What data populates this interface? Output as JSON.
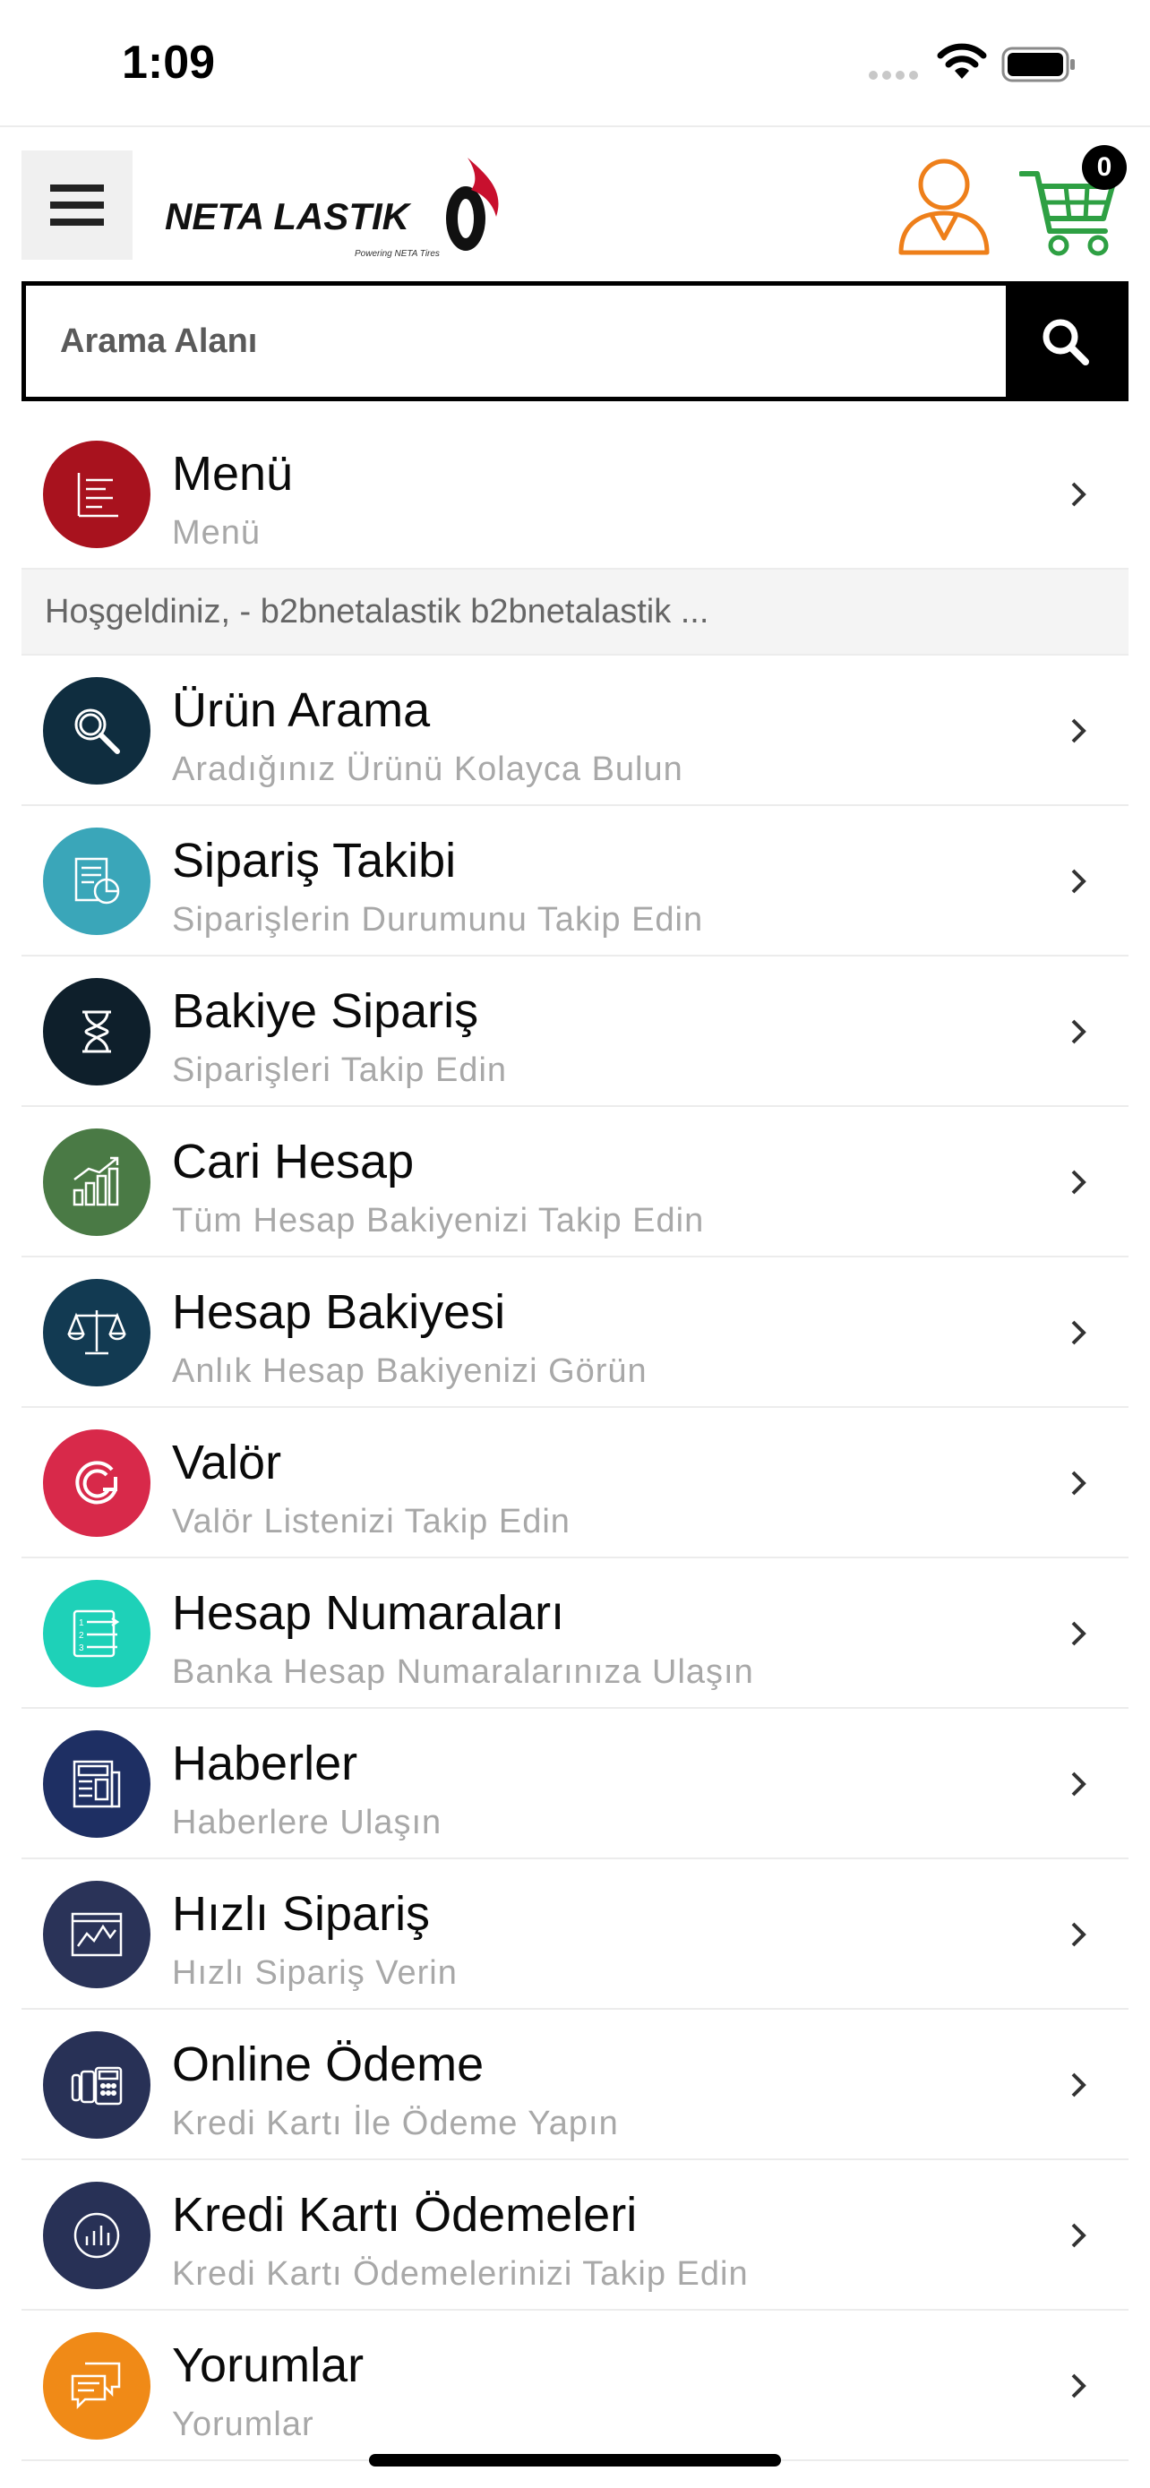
{
  "status": {
    "time": "1:09"
  },
  "header": {
    "logo_text": "NETA LASTIK",
    "logo_tagline": "Powering NETA Tires",
    "cart_count": "0"
  },
  "search": {
    "placeholder": "Arama Alanı"
  },
  "menu_header": {
    "title": "Menü",
    "subtitle": "Menü",
    "icon": "list-icon",
    "color": "#a8121e"
  },
  "welcome": "Hoşgeldiniz, - b2bnetalastik b2bnetalastik ...",
  "items": [
    {
      "title": "Ürün Arama",
      "subtitle": "Aradığınız Ürünü Kolayca Bulun",
      "icon": "magnifier-icon",
      "color": "#0f2d3f"
    },
    {
      "title": "Sipariş Takibi",
      "subtitle": "Siparişlerin Durumunu Takip Edin",
      "icon": "order-tracking-icon",
      "color": "#3aa6b9"
    },
    {
      "title": "Bakiye Sipariş",
      "subtitle": "Siparişleri Takip Edin",
      "icon": "hourglass-icon",
      "color": "#0e1f2b"
    },
    {
      "title": "Cari Hesap",
      "subtitle": "Tüm Hesap Bakiyenizi Takip Edin",
      "icon": "bar-chart-icon",
      "color": "#4a7a45"
    },
    {
      "title": "Hesap Bakiyesi",
      "subtitle": "Anlık Hesap Bakiyenizi Görün",
      "icon": "scales-icon",
      "color": "#123a52"
    },
    {
      "title": "Valör",
      "subtitle": "Valör Listenizi Takip Edin",
      "icon": "refresh-circle-icon",
      "color": "#d8294a"
    },
    {
      "title": "Hesap Numaraları",
      "subtitle": "Banka Hesap Numaralarınıza Ulaşın",
      "icon": "numbered-list-icon",
      "color": "#1ed1b8"
    },
    {
      "title": "Haberler",
      "subtitle": "Haberlere Ulaşın",
      "icon": "newspaper-icon",
      "color": "#1e2f63"
    },
    {
      "title": "Hızlı Sipariş",
      "subtitle": "Hızlı Sipariş Verin",
      "icon": "line-chart-icon",
      "color": "#2a3358"
    },
    {
      "title": "Online Ödeme",
      "subtitle": "Kredi Kartı İle Ödeme Yapın",
      "icon": "pos-terminal-icon",
      "color": "#283156"
    },
    {
      "title": "Kredi Kartı Ödemeleri",
      "subtitle": "Kredi Kartı Ödemelerinizi Takip Edin",
      "icon": "chart-circle-icon",
      "color": "#283156"
    },
    {
      "title": "Yorumlar",
      "subtitle": "Yorumlar",
      "icon": "comments-icon",
      "color": "#f08a17"
    }
  ]
}
